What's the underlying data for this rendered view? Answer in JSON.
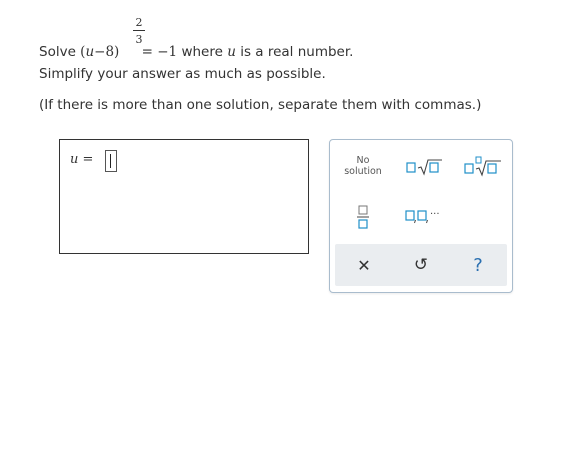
{
  "question": {
    "line1_prefix": "Solve",
    "base_open": "(",
    "base_var": "u",
    "base_rest": "−8)",
    "exponent_num": "2",
    "exponent_den": "3",
    "equals": "= −1",
    "line1_mid": "where",
    "line1_var": "u",
    "line1_suffix": "is a real number.",
    "line2": "Simplify your answer as much as possible.",
    "line3": "(If there is more than one solution, separate them with commas.)"
  },
  "answer": {
    "label_var": "u",
    "label_eq": "=",
    "value": ""
  },
  "palette": {
    "no_solution_line1": "No",
    "no_solution_line2": "solution",
    "list_ellipsis": "...",
    "clear_symbol": "✕",
    "undo_symbol": "↺",
    "help_symbol": "?"
  },
  "colors": {
    "palette_border": "#a9bccd",
    "template_box_blue": "#1f8fc9",
    "action_bar_bg": "#eaedf0",
    "help_blue": "#2a6fb0"
  }
}
